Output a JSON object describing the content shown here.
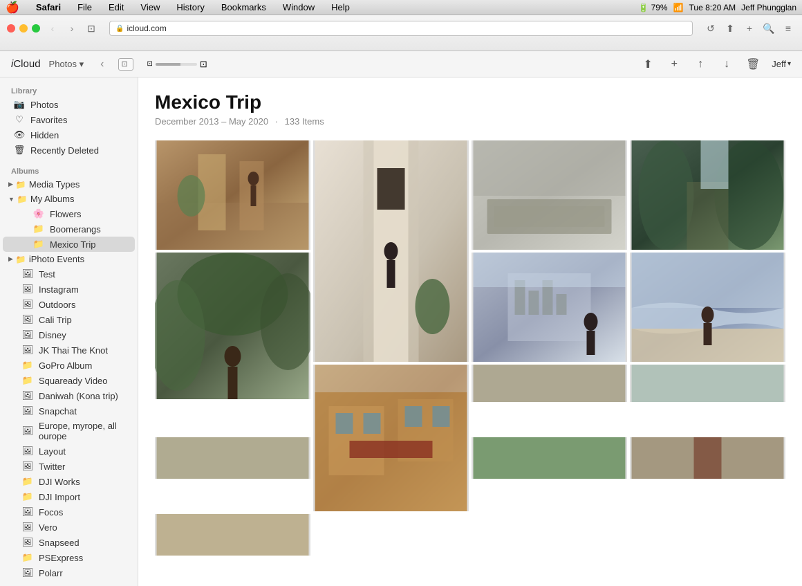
{
  "menubar": {
    "apple": "🍎",
    "items": [
      "Safari",
      "File",
      "Edit",
      "View",
      "History",
      "Bookmarks",
      "Window",
      "Help"
    ],
    "right": "Tue 8:20 AM  Jeff Phungglan",
    "battery": "79%"
  },
  "browser": {
    "url": "icloud.com",
    "back_disabled": true,
    "forward_disabled": false
  },
  "toolbar": {
    "brand": "iCloud",
    "app_name": "Photos",
    "back_label": "‹",
    "user_label": "Jeff",
    "upload_icon": "↑",
    "add_icon": "+",
    "share_icon": "↑",
    "download_icon": "↓",
    "trash_icon": "🗑"
  },
  "sidebar": {
    "library_label": "Library",
    "library_items": [
      {
        "id": "photos",
        "label": "Photos",
        "icon": "📷"
      },
      {
        "id": "favorites",
        "label": "Favorites",
        "icon": "♡"
      },
      {
        "id": "hidden",
        "label": "Hidden",
        "icon": "👁"
      },
      {
        "id": "recently-deleted",
        "label": "Recently Deleted",
        "icon": "🗑"
      }
    ],
    "albums_label": "Albums",
    "media_types_label": "Media Types",
    "my_albums_label": "My Albums",
    "album_items": [
      {
        "id": "flowers",
        "label": "Flowers",
        "icon": "🌸",
        "indent": 2
      },
      {
        "id": "boomerangs",
        "label": "Boomerangs",
        "icon": "📁",
        "indent": 2
      },
      {
        "id": "mexico-trip",
        "label": "Mexico Trip",
        "icon": "📁",
        "indent": 2,
        "active": true
      }
    ],
    "iphoto_events_label": "iPhoto Events",
    "other_albums": [
      {
        "id": "test",
        "label": "Test",
        "icon": "🖼",
        "indent": 1
      },
      {
        "id": "instagram",
        "label": "Instagram",
        "icon": "🖼",
        "indent": 1
      },
      {
        "id": "outdoors",
        "label": "Outdoors",
        "icon": "🖼",
        "indent": 1
      },
      {
        "id": "cali-trip",
        "label": "Cali Trip",
        "icon": "🖼",
        "indent": 1
      },
      {
        "id": "disney",
        "label": "Disney",
        "icon": "🖼",
        "indent": 1
      },
      {
        "id": "jk-thai",
        "label": "JK Thai The Knot",
        "icon": "🖼",
        "indent": 1
      },
      {
        "id": "gopro",
        "label": "GoPro Album",
        "icon": "📁",
        "indent": 1
      },
      {
        "id": "squaready",
        "label": "Squaready Video",
        "icon": "📁",
        "indent": 1
      },
      {
        "id": "daniwah",
        "label": "Daniwah (Kona trip)",
        "icon": "🖼",
        "indent": 1
      },
      {
        "id": "snapchat",
        "label": "Snapchat",
        "icon": "🖼",
        "indent": 1
      },
      {
        "id": "europe",
        "label": "Europe, myrope, all ourope",
        "icon": "🖼",
        "indent": 1
      },
      {
        "id": "layout",
        "label": "Layout",
        "icon": "🖼",
        "indent": 1
      },
      {
        "id": "twitter",
        "label": "Twitter",
        "icon": "🖼",
        "indent": 1
      },
      {
        "id": "dji-works",
        "label": "DJI Works",
        "icon": "📁",
        "indent": 1
      },
      {
        "id": "dji-import",
        "label": "DJI Import",
        "icon": "📁",
        "indent": 1
      },
      {
        "id": "focos",
        "label": "Focos",
        "icon": "🖼",
        "indent": 1
      },
      {
        "id": "vero",
        "label": "Vero",
        "icon": "🖼",
        "indent": 1
      },
      {
        "id": "snapseed",
        "label": "Snapseed",
        "icon": "🖼",
        "indent": 1
      },
      {
        "id": "psexpress",
        "label": "PSExpress",
        "icon": "📁",
        "indent": 1
      },
      {
        "id": "polarr",
        "label": "Polarr",
        "icon": "🖼",
        "indent": 1
      }
    ]
  },
  "album": {
    "title": "Mexico Trip",
    "date_range": "December 2013 – May 2020",
    "item_count": "133 Items"
  },
  "photos": [
    {
      "id": 1,
      "class": "p1",
      "tall": false
    },
    {
      "id": 2,
      "class": "p2",
      "tall": true
    },
    {
      "id": 3,
      "class": "p3",
      "tall": false
    },
    {
      "id": 4,
      "class": "p4",
      "tall": false
    },
    {
      "id": 5,
      "class": "p5",
      "tall": true
    },
    {
      "id": 6,
      "class": "p6",
      "tall": false
    },
    {
      "id": 7,
      "class": "p7",
      "tall": false
    },
    {
      "id": 8,
      "class": "p8",
      "tall": true
    },
    {
      "id": 9,
      "class": "p9",
      "tall": false
    },
    {
      "id": 10,
      "class": "p10",
      "tall": false
    },
    {
      "id": 11,
      "class": "p11",
      "tall": false
    }
  ]
}
